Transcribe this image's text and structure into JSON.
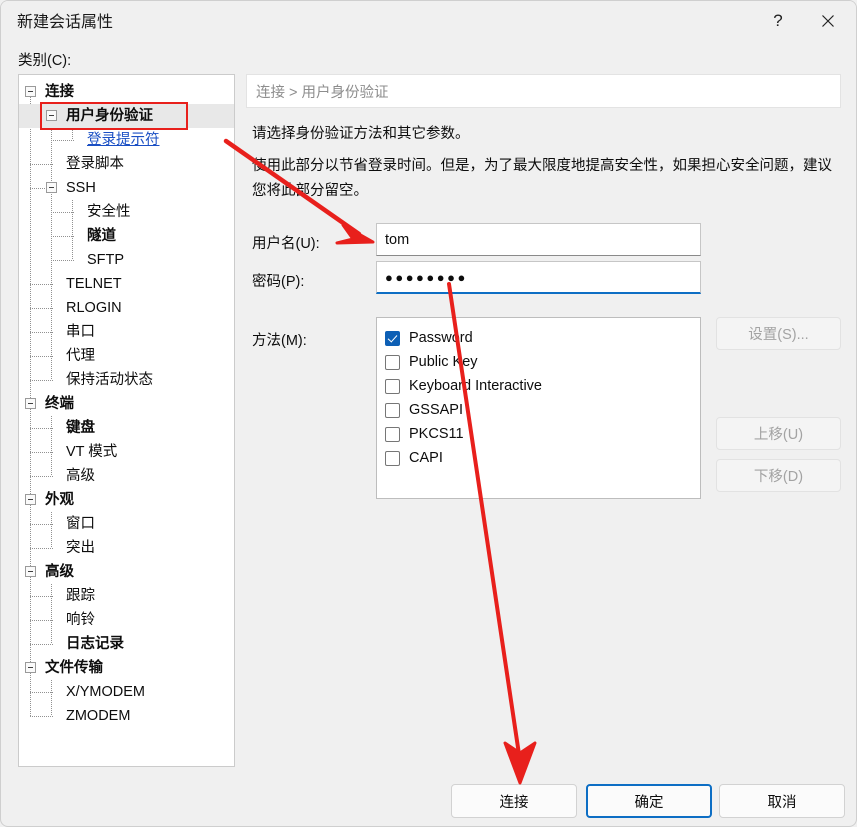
{
  "window": {
    "title": "新建会话属性",
    "help_icon": "?",
    "close_icon": "close-icon"
  },
  "category": {
    "label": "类别(C):",
    "tree": [
      {
        "label": "连接",
        "level": 0,
        "bold": true,
        "expander": true,
        "selected": false,
        "link": false
      },
      {
        "label": "用户身份验证",
        "level": 1,
        "bold": true,
        "expander": true,
        "selected": true,
        "link": false
      },
      {
        "label": "登录提示符",
        "level": 2,
        "bold": false,
        "expander": false,
        "selected": false,
        "link": true
      },
      {
        "label": "登录脚本",
        "level": 1,
        "bold": false,
        "expander": false,
        "selected": false,
        "link": false
      },
      {
        "label": "SSH",
        "level": 1,
        "bold": false,
        "expander": true,
        "selected": false,
        "link": false
      },
      {
        "label": "安全性",
        "level": 2,
        "bold": false,
        "expander": false,
        "selected": false,
        "link": false
      },
      {
        "label": "隧道",
        "level": 2,
        "bold": true,
        "expander": false,
        "selected": false,
        "link": false
      },
      {
        "label": "SFTP",
        "level": 2,
        "bold": false,
        "expander": false,
        "selected": false,
        "link": false
      },
      {
        "label": "TELNET",
        "level": 1,
        "bold": false,
        "expander": false,
        "selected": false,
        "link": false
      },
      {
        "label": "RLOGIN",
        "level": 1,
        "bold": false,
        "expander": false,
        "selected": false,
        "link": false
      },
      {
        "label": "串口",
        "level": 1,
        "bold": false,
        "expander": false,
        "selected": false,
        "link": false
      },
      {
        "label": "代理",
        "level": 1,
        "bold": false,
        "expander": false,
        "selected": false,
        "link": false
      },
      {
        "label": "保持活动状态",
        "level": 1,
        "bold": false,
        "expander": false,
        "selected": false,
        "link": false
      },
      {
        "label": "终端",
        "level": 0,
        "bold": true,
        "expander": true,
        "selected": false,
        "link": false
      },
      {
        "label": "键盘",
        "level": 1,
        "bold": true,
        "expander": false,
        "selected": false,
        "link": false
      },
      {
        "label": "VT 模式",
        "level": 1,
        "bold": false,
        "expander": false,
        "selected": false,
        "link": false
      },
      {
        "label": "高级",
        "level": 1,
        "bold": false,
        "expander": false,
        "selected": false,
        "link": false
      },
      {
        "label": "外观",
        "level": 0,
        "bold": true,
        "expander": true,
        "selected": false,
        "link": false
      },
      {
        "label": "窗口",
        "level": 1,
        "bold": false,
        "expander": false,
        "selected": false,
        "link": false
      },
      {
        "label": "突出",
        "level": 1,
        "bold": false,
        "expander": false,
        "selected": false,
        "link": false
      },
      {
        "label": "高级",
        "level": 0,
        "bold": true,
        "expander": true,
        "selected": false,
        "link": false
      },
      {
        "label": "跟踪",
        "level": 1,
        "bold": false,
        "expander": false,
        "selected": false,
        "link": false
      },
      {
        "label": "响铃",
        "level": 1,
        "bold": false,
        "expander": false,
        "selected": false,
        "link": false
      },
      {
        "label": "日志记录",
        "level": 1,
        "bold": true,
        "expander": false,
        "selected": false,
        "link": false
      },
      {
        "label": "文件传输",
        "level": 0,
        "bold": true,
        "expander": true,
        "selected": false,
        "link": false
      },
      {
        "label": "X/YMODEM",
        "level": 1,
        "bold": false,
        "expander": false,
        "selected": false,
        "link": false
      },
      {
        "label": "ZMODEM",
        "level": 1,
        "bold": false,
        "expander": false,
        "selected": false,
        "link": false
      }
    ]
  },
  "main": {
    "breadcrumb": "连接 > 用户身份验证",
    "description_1": "请选择身份验证方法和其它参数。",
    "description_2": "使用此部分以节省登录时间。但是，为了最大限度地提高安全性，如果担心安全问题，建议您将此部分留空。",
    "username": {
      "label": "用户名(U):",
      "value": "tom"
    },
    "password": {
      "label": "密码(P):",
      "value": "●●●●●●●●"
    },
    "method": {
      "label": "方法(M):",
      "items": [
        {
          "label": "Password",
          "checked": true
        },
        {
          "label": "Public Key",
          "checked": false
        },
        {
          "label": "Keyboard Interactive",
          "checked": false
        },
        {
          "label": "GSSAPI",
          "checked": false
        },
        {
          "label": "PKCS11",
          "checked": false
        },
        {
          "label": "CAPI",
          "checked": false
        }
      ]
    },
    "side_buttons": [
      {
        "label": "设置(S)...",
        "disabled": true
      },
      {
        "label": "上移(U)",
        "disabled": true
      },
      {
        "label": "下移(D)",
        "disabled": true
      }
    ]
  },
  "footer": {
    "connect": "连接",
    "ok": "确定",
    "cancel": "取消"
  },
  "annotations": {
    "color": "#e8201c",
    "highlight_target": "用户身份验证",
    "arrow_1_target": "用户名(U) 输入框",
    "arrow_2_target": "连接 按钮"
  },
  "colors": {
    "accent_blue": "#0d6ec4",
    "checkbox_blue": "#0d5fb5",
    "link_blue": "#1a4fc4",
    "annotation_red": "#e8201c",
    "dialog_bg": "#f0f0f0",
    "panel_white": "#ffffff"
  }
}
